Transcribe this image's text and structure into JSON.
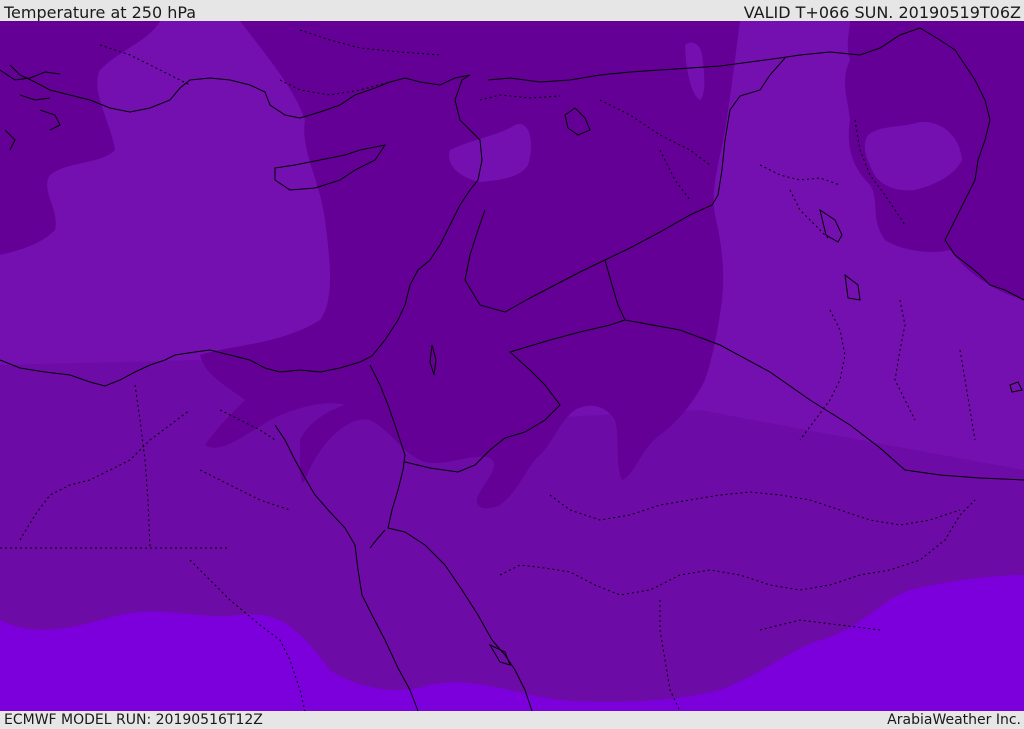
{
  "header": {
    "title": "Temperature at 250 hPa",
    "valid": "VALID T+066 SUN. 20190519T06Z"
  },
  "footer": {
    "model_run": "ECMWF MODEL RUN: 20190516T12Z",
    "credit": "ArabiaWeather Inc."
  },
  "colors": {
    "band_darkest": "#640096",
    "band_mid": "#7510b0",
    "band_south": "#6d0ba6",
    "band_bright": "#7c00db",
    "band_light": "#8222c4",
    "border_line": "#000000"
  }
}
